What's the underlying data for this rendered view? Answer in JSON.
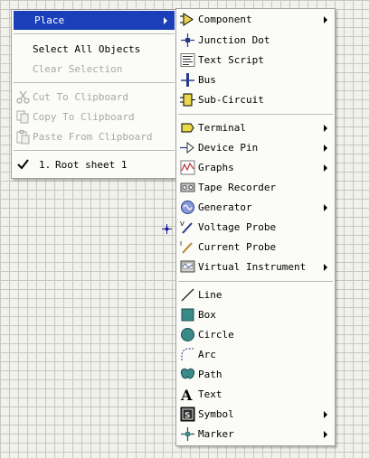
{
  "context_menu": {
    "items": [
      {
        "label": "Place",
        "disabled": false,
        "highlighted": true,
        "submenu": true
      },
      {
        "label": "Select All Objects",
        "disabled": false
      },
      {
        "label": "Clear Selection",
        "disabled": true
      },
      {
        "label": "Cut To Clipboard",
        "disabled": true,
        "icon": "scissors-icon"
      },
      {
        "label": "Copy To Clipboard",
        "disabled": true,
        "icon": "copy-icon"
      },
      {
        "label": "Paste From Clipboard",
        "disabled": true,
        "icon": "paste-icon"
      },
      {
        "label": "Root sheet 1",
        "prefix": "1.",
        "checked": true,
        "icon": "check-icon"
      }
    ],
    "highlight_color": "#1a3fb8"
  },
  "place_submenu": {
    "items": [
      {
        "label": "Component",
        "icon": "component-icon",
        "submenu": true
      },
      {
        "label": "Junction Dot",
        "icon": "junction-dot-icon"
      },
      {
        "label": "Text Script",
        "icon": "text-script-icon"
      },
      {
        "label": "Bus",
        "icon": "bus-icon"
      },
      {
        "label": "Sub-Circuit",
        "icon": "sub-circuit-icon"
      },
      {
        "label": "Terminal",
        "icon": "terminal-icon",
        "submenu": true
      },
      {
        "label": "Device Pin",
        "icon": "device-pin-icon",
        "submenu": true
      },
      {
        "label": "Graphs",
        "icon": "graphs-icon",
        "submenu": true
      },
      {
        "label": "Tape Recorder",
        "icon": "tape-recorder-icon"
      },
      {
        "label": "Generator",
        "icon": "generator-icon",
        "submenu": true
      },
      {
        "label": "Voltage Probe",
        "icon": "voltage-probe-icon"
      },
      {
        "label": "Current Probe",
        "icon": "current-probe-icon"
      },
      {
        "label": "Virtual Instrument",
        "icon": "virtual-instrument-icon",
        "submenu": true
      },
      {
        "label": "Line",
        "icon": "line-icon"
      },
      {
        "label": "Box",
        "icon": "box-icon"
      },
      {
        "label": "Circle",
        "icon": "circle-icon"
      },
      {
        "label": "Arc",
        "icon": "arc-icon"
      },
      {
        "label": "Path",
        "icon": "path-icon"
      },
      {
        "label": "Text",
        "icon": "text-icon"
      },
      {
        "label": "Symbol",
        "icon": "symbol-icon",
        "submenu": true
      },
      {
        "label": "Marker",
        "icon": "marker-icon",
        "submenu": true
      }
    ]
  }
}
